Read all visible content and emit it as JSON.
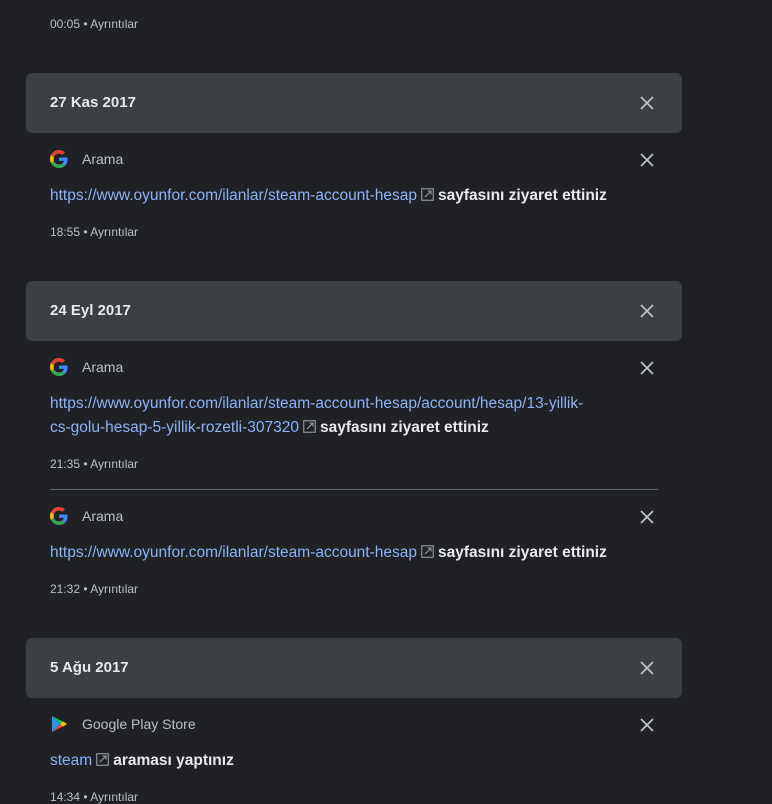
{
  "top_meta": {
    "time": "00:05",
    "details": "Ayrıntılar"
  },
  "groups": [
    {
      "date": "27 Kas 2017",
      "items": [
        {
          "source": "Arama",
          "link": "https://www.oyunfor.com/ilanlar/steam-account-hesap",
          "suffix": "sayfasını ziyaret ettiniz",
          "time": "18:55",
          "details": "Ayrıntılar"
        }
      ]
    },
    {
      "date": "24 Eyl 2017",
      "items": [
        {
          "source": "Arama",
          "link_line1": "https://www.oyunfor.com/ilanlar/steam-account-hesap/account/hesap/13-yillik-",
          "link_line2": "cs-golu-hesap-5-yillik-rozetli-307320",
          "suffix": "sayfasını ziyaret ettiniz",
          "time": "21:35",
          "details": "Ayrıntılar"
        },
        {
          "source": "Arama",
          "link": "https://www.oyunfor.com/ilanlar/steam-account-hesap",
          "suffix": "sayfasını ziyaret ettiniz",
          "time": "21:32",
          "details": "Ayrıntılar"
        }
      ]
    },
    {
      "date": "5 Ağu 2017",
      "items": [
        {
          "source": "Google Play Store",
          "link": "steam",
          "suffix": "araması yaptınız",
          "time": "14:34",
          "details": "Ayrıntılar"
        }
      ]
    }
  ],
  "separator": " • ",
  "icons": {
    "google": "google-g-icon",
    "play": "google-play-icon",
    "close": "close-icon",
    "external": "external-link-icon"
  },
  "colors": {
    "background": "#202124",
    "header": "#3c4043",
    "link": "#8ab4f8"
  }
}
